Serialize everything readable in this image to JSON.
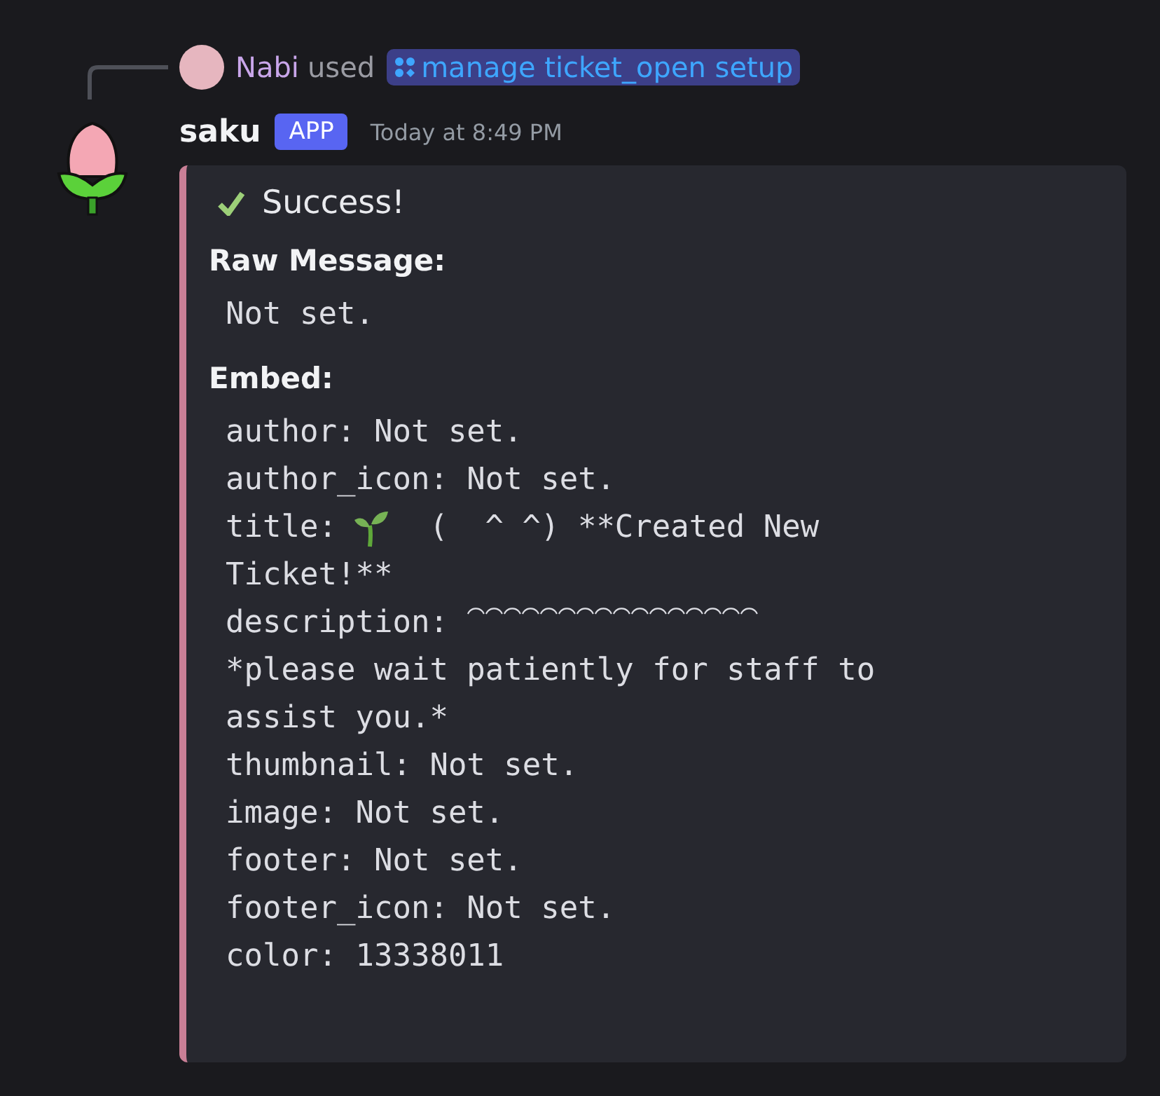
{
  "reply": {
    "user": "Nabi",
    "verb": "used",
    "command": "manage ticket_open setup"
  },
  "message": {
    "author": "saku",
    "badge": "APP",
    "timestamp": "Today at 8:49 PM"
  },
  "embed": {
    "color": "#c97f96",
    "status": "Success!",
    "sections": [
      {
        "heading": "Raw Message:",
        "lines": [
          {
            "kind": "text",
            "text": "Not set."
          }
        ]
      },
      {
        "heading": "Embed:",
        "lines": [
          {
            "kind": "text",
            "text": "author: Not set."
          },
          {
            "kind": "text",
            "text": "author_icon: Not set."
          },
          {
            "kind": "sprout",
            "key": "title:",
            "text": "(  ^ ^) **Created New"
          },
          {
            "kind": "text",
            "text": "Ticket!**"
          },
          {
            "kind": "text",
            "text": "description: ⁀⁀⁀⁀⁀⁀⁀⁀⁀⁀⁀⁀⁀⁀⁀⁀"
          },
          {
            "kind": "text",
            "text": "*please wait patiently for staff to"
          },
          {
            "kind": "text",
            "text": "assist you.*"
          },
          {
            "kind": "text",
            "text": "thumbnail: Not set."
          },
          {
            "kind": "text",
            "text": "image: Not set."
          },
          {
            "kind": "text",
            "text": "footer: Not set."
          },
          {
            "kind": "text",
            "text": "footer_icon: Not set."
          },
          {
            "kind": "text",
            "text": "color: 13338011"
          }
        ]
      }
    ]
  }
}
